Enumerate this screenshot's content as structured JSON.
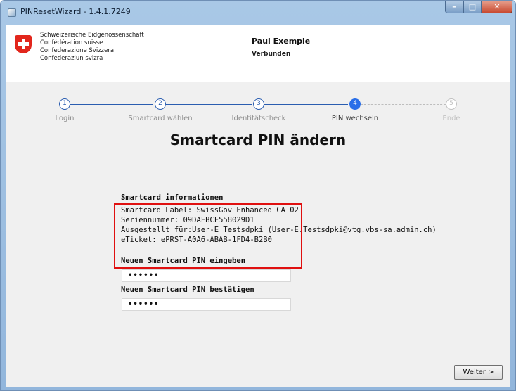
{
  "window": {
    "title": "PINResetWizard - 1.4.1.7249",
    "minimize": "–",
    "maximize": "□",
    "close": "✕"
  },
  "header": {
    "confederation": [
      "Schweizerische Eidgenossenschaft",
      "Confédération suisse",
      "Confederazione Svizzera",
      "Confederaziun svizra"
    ],
    "user_name": "Paul Exemple",
    "user_status": "Verbunden"
  },
  "steps": [
    {
      "number": "1",
      "label": "Login",
      "state": "done"
    },
    {
      "number": "2",
      "label": "Smartcard wählen",
      "state": "done"
    },
    {
      "number": "3",
      "label": "Identitätscheck",
      "state": "done"
    },
    {
      "number": "4",
      "label": "PIN wechseln",
      "state": "active"
    },
    {
      "number": "5",
      "label": "Ende",
      "state": "pending"
    }
  ],
  "page_title": "Smartcard PIN ändern",
  "info": {
    "heading": "Smartcard informationen",
    "lines": [
      "Smartcard Label: SwissGov Enhanced CA 02",
      "Seriennummer: 09DAFBCF558029D1",
      "Ausgestellt für:User-E Testsdpki (User-E.Testsdpki@vtg.vbs-sa.admin.ch)",
      "eTicket: ePRST-A0A6-ABAB-1FD4-B2B0"
    ]
  },
  "form": {
    "new_pin_label": "Neuen Smartcard PIN eingeben",
    "new_pin_value": "••••••",
    "confirm_pin_label": "Neuen Smartcard PIN bestätigen",
    "confirm_pin_value": "••••••"
  },
  "footer": {
    "next_label": "Weiter >"
  },
  "colors": {
    "accent": "#2a6fe8",
    "highlight": "#e01010",
    "swiss_red": "#e2261c"
  }
}
